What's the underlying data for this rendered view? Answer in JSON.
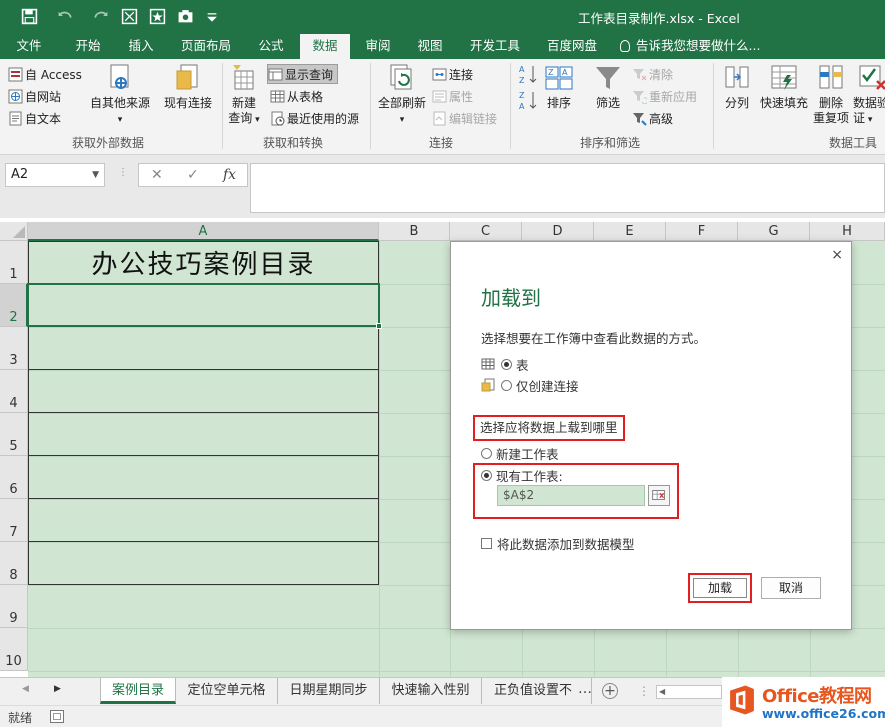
{
  "window": {
    "title": "工作表目录制作.xlsx - Excel",
    "accent": "#217346"
  },
  "ribbon_tabs": [
    "文件",
    "开始",
    "插入",
    "页面布局",
    "公式",
    "数据",
    "审阅",
    "视图",
    "开发工具",
    "百度网盘"
  ],
  "active_tab": "数据",
  "tell_me": "告诉我您想要做什么...",
  "groups": {
    "external": {
      "label": "获取外部数据",
      "access": "自 Access",
      "web": "自网站",
      "text": "自文本",
      "other": "自其他来源",
      "existing": "现有连接"
    },
    "transform": {
      "label": "获取和转换",
      "new_query_1": "新建",
      "new_query_2": "查询",
      "show_queries": "显示查询",
      "from_table": "从表格",
      "recent_sources": "最近使用的源"
    },
    "connections": {
      "label": "连接",
      "refresh_all": "全部刷新",
      "connections": "连接",
      "properties": "属性",
      "edit_links": "编辑链接"
    },
    "sort_filter": {
      "label": "排序和筛选",
      "sort": "排序",
      "filter": "筛选",
      "clear": "清除",
      "reapply": "重新应用",
      "advanced": "高级"
    },
    "data_tools": {
      "label": "数据工具",
      "split": "分列",
      "flash_fill": "快速填充",
      "remove_dup_1": "删除",
      "remove_dup_2": "重复项",
      "validation_1": "数据验",
      "validation_2": "证"
    }
  },
  "formula_bar": {
    "name_box": "A2",
    "cancel": "✕",
    "enter": "✓",
    "fx": "fx",
    "value": ""
  },
  "columns": [
    "A",
    "B",
    "C",
    "D",
    "E",
    "F",
    "G",
    "H"
  ],
  "rows": [
    "1",
    "2",
    "3",
    "4",
    "5",
    "6",
    "7",
    "8",
    "9",
    "10"
  ],
  "cells": {
    "A1": "办公技巧案例目录"
  },
  "dialog": {
    "title": "加载到",
    "close": "×",
    "question1": "选择想要在工作簿中查看此数据的方式。",
    "opt_table": "表",
    "opt_connection": "仅创建连接",
    "question2": "选择应将数据上载到哪里",
    "opt_new_sheet": "新建工作表",
    "opt_existing_sheet": "现有工作表:",
    "range_ref": "$A$2",
    "add_to_model": "将此数据添加到数据模型",
    "load_button": "加载",
    "cancel_button": "取消"
  },
  "sheet_tabs": [
    "案例目录",
    "定位空单元格",
    "日期星期同步",
    "快速输入性别",
    "正负值设置不"
  ],
  "active_sheet": "案例目录",
  "status": "就绪",
  "watermark": {
    "brand": "Office教程网",
    "url": "www.office26.com"
  }
}
